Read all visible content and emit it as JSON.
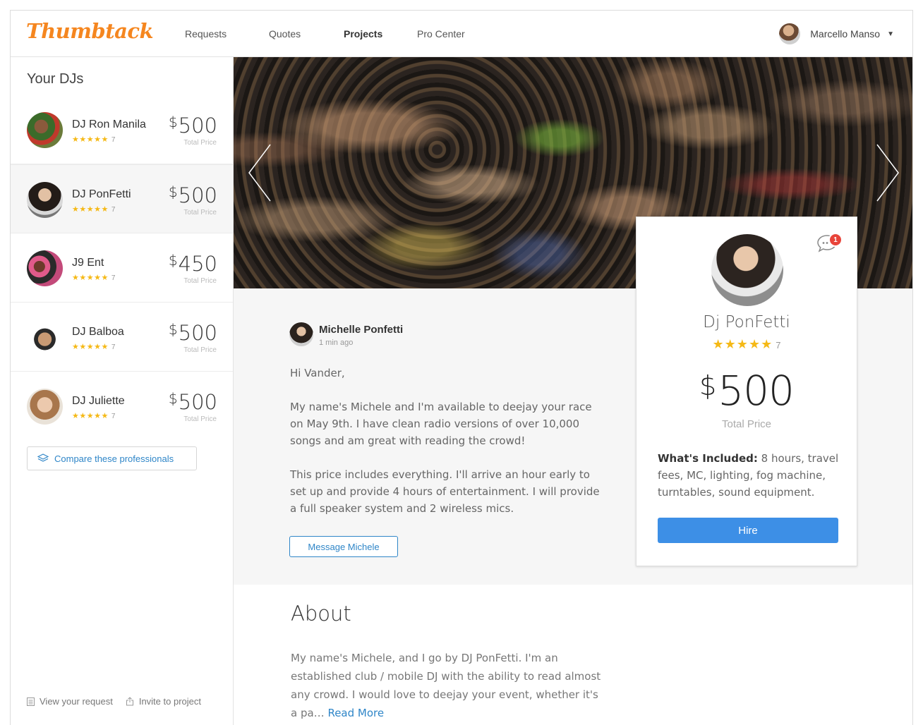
{
  "header": {
    "logo": "Thumbtack",
    "nav": [
      {
        "label": "Requests"
      },
      {
        "label": "Quotes"
      },
      {
        "label": "Projects"
      },
      {
        "label": "Pro Center"
      }
    ],
    "user_name": "Marcello Manso",
    "user_caret": "▼"
  },
  "sidebar": {
    "title": "Your DJs",
    "djs": [
      {
        "name": "DJ Ron Manila",
        "stars": "★★★★★",
        "rating_count": "7",
        "currency": "$",
        "price": "500",
        "price_label": "Total Price"
      },
      {
        "name": "DJ PonFetti",
        "stars": "★★★★★",
        "rating_count": "7",
        "currency": "$",
        "price": "500",
        "price_label": "Total Price"
      },
      {
        "name": "J9 Ent",
        "stars": "★★★★★",
        "rating_count": "7",
        "currency": "$",
        "price": "450",
        "price_label": "Total Price"
      },
      {
        "name": "DJ Balboa",
        "stars": "★★★★★",
        "rating_count": "7",
        "currency": "$",
        "price": "500",
        "price_label": "Total Price"
      },
      {
        "name": "DJ Juliette",
        "stars": "★★★★★",
        "rating_count": "7",
        "currency": "$",
        "price": "500",
        "price_label": "Total Price"
      }
    ],
    "compare_label": "Compare these professionals",
    "footer": {
      "view_request": "View your request",
      "invite": "Invite to project"
    }
  },
  "message": {
    "sender": "Michelle Ponfetti",
    "time": "1 min ago",
    "greeting": "Hi Vander,",
    "para1": "My name's Michele and I'm available to deejay your race on May 9th. I have clean radio versions of over 10,000 songs and am great with reading the crowd!",
    "para2": "This price includes everything. I'll arrive an hour early to set up and provide 4 hours of entertainment. I will provide a full speaker system and 2 wireless mics.",
    "button": "Message Michele"
  },
  "card": {
    "name": "Dj PonFetti",
    "stars": "★★★★★",
    "rating_count": "7",
    "currency": "$",
    "price": "500",
    "price_label": "Total Price",
    "included_label": "What's Included:",
    "included_text": " 8 hours, travel fees, MC, lighting, fog machine, turntables, sound equipment.",
    "unread_count": "1",
    "hire": "Hire"
  },
  "about": {
    "title": "About",
    "text": "My name's Michele, and I go by DJ PonFetti. I'm an established club / mobile DJ with the ability to read almost any crowd. I would love to deejay your event, whether it's a pa… ",
    "read_more": "Read More"
  },
  "colors": {
    "brand": "#f5861f",
    "link": "#2f86c8",
    "hire_button": "#3d8fe6",
    "stars": "#f5b916",
    "badge": "#e8443a"
  },
  "icons": [
    "chevron-left-icon",
    "chevron-right-icon",
    "chat-bubble-icon",
    "layers-icon",
    "document-icon",
    "share-icon",
    "caret-down-icon"
  ]
}
